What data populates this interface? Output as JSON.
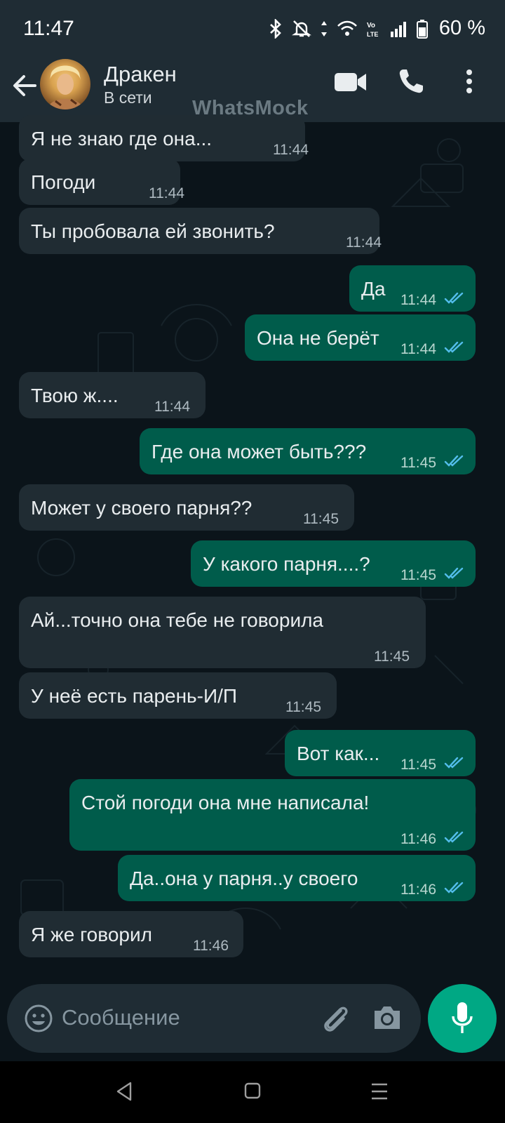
{
  "status_bar": {
    "time": "11:47",
    "battery": "60 %"
  },
  "header": {
    "back_icon": "arrow-left-icon",
    "contact_name": "Дракен",
    "contact_status": "В сети",
    "watermark": "WhatsMock",
    "video_icon": "video-call-icon",
    "call_icon": "phone-icon",
    "menu_icon": "more-vertical-icon"
  },
  "messages": [
    {
      "dir": "in",
      "text": "Я не знаю где она...",
      "time": "11:44"
    },
    {
      "dir": "in",
      "text": "Погоди",
      "time": "11:44"
    },
    {
      "dir": "in",
      "text": "Ты пробовала ей звонить?",
      "time": "11:44"
    },
    {
      "dir": "out",
      "text": "Да",
      "time": "11:44",
      "read": true
    },
    {
      "dir": "out",
      "text": "Она не берёт",
      "time": "11:44",
      "read": true
    },
    {
      "dir": "in",
      "text": "Твою ж....",
      "time": "11:44"
    },
    {
      "dir": "out",
      "text": "Где она может быть???",
      "time": "11:45",
      "read": true
    },
    {
      "dir": "in",
      "text": "Может у своего парня??",
      "time": "11:45"
    },
    {
      "dir": "out",
      "text": "У какого парня....?",
      "time": "11:45",
      "read": true
    },
    {
      "dir": "in",
      "text": "Ай...точно она тебе не говорила",
      "time": "11:45"
    },
    {
      "dir": "in",
      "text": "У неё есть парень-И/П",
      "time": "11:45"
    },
    {
      "dir": "out",
      "text": "Вот как...",
      "time": "11:45",
      "read": true
    },
    {
      "dir": "out",
      "text": "Стой погоди она мне написала!",
      "time": "11:46",
      "read": true
    },
    {
      "dir": "out",
      "text": "Да..она у парня..у своего",
      "time": "11:46",
      "read": true
    },
    {
      "dir": "in",
      "text": "Я же говорил",
      "time": "11:46"
    }
  ],
  "input": {
    "placeholder": "Сообщение",
    "emoji_icon": "emoji-icon",
    "attach_icon": "paperclip-icon",
    "camera_icon": "camera-icon",
    "mic_icon": "microphone-icon"
  },
  "colors": {
    "incoming": "#202c33",
    "outgoing": "#005c4b",
    "accent": "#00a884",
    "read_tick": "#53bdeb"
  }
}
